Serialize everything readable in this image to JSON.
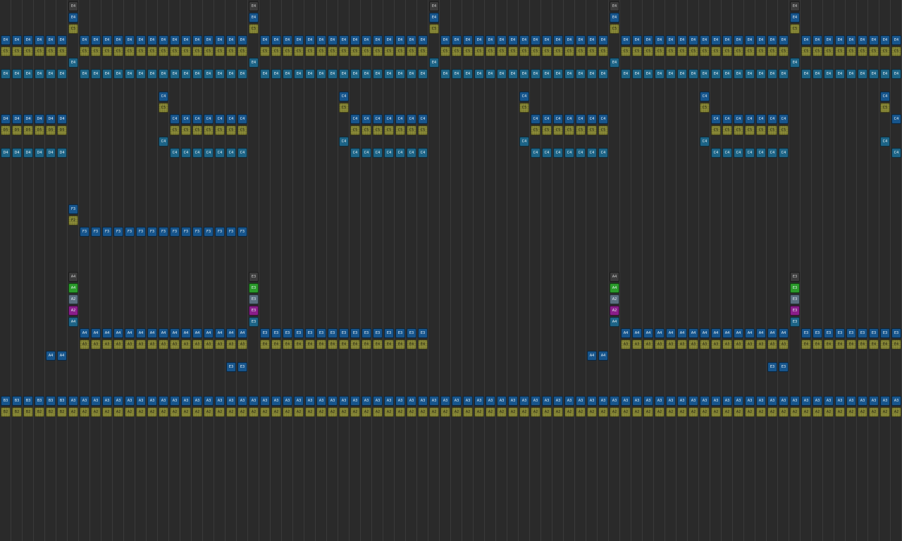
{
  "palette": {
    "background": "#2a2a2a",
    "gridline": "#3a3a3a",
    "dark": "#3c3c3c",
    "blue": "#17558c",
    "teal": "#1d6486",
    "olive": "#8b8b38",
    "green": "#2a9a2a",
    "slate": "#5a6f80",
    "purple": "#8a1e8a"
  },
  "note_rows": [
    {
      "name": "row-e4-top",
      "cols": [
        6,
        22,
        38,
        54,
        70
      ],
      "label": "E4",
      "style": "dark"
    },
    {
      "name": "row-e4-second",
      "cols": [
        6,
        22,
        38,
        54,
        70
      ],
      "label": "E4",
      "style": "blue"
    },
    {
      "name": "row-c5-top",
      "cols": [
        6,
        22,
        38,
        54,
        70
      ],
      "label": "C5",
      "style": "olive"
    },
    {
      "name": "row-e4-run",
      "cols": [
        0,
        1,
        2,
        3,
        4,
        5,
        7,
        8,
        9,
        10,
        11,
        12,
        13,
        14,
        15,
        16,
        17,
        18,
        19,
        20,
        21,
        23,
        24,
        25,
        26,
        27,
        28,
        29,
        30,
        31,
        32,
        33,
        34,
        35,
        36,
        37,
        39,
        40,
        41,
        42,
        43,
        44,
        45,
        46,
        47,
        48,
        49,
        50,
        51,
        52,
        53,
        55,
        56,
        57,
        58,
        59,
        60,
        61,
        62,
        63,
        64,
        65,
        66,
        67,
        68,
        69,
        71,
        72,
        73,
        74,
        75,
        76,
        77,
        78,
        79
      ],
      "label": "E4",
      "style": "blue"
    },
    {
      "name": "row-c5-run",
      "cols": [
        0,
        1,
        2,
        3,
        4,
        5,
        7,
        8,
        9,
        10,
        11,
        12,
        13,
        14,
        15,
        16,
        17,
        18,
        19,
        20,
        21,
        23,
        24,
        25,
        26,
        27,
        28,
        29,
        30,
        31,
        32,
        33,
        34,
        35,
        36,
        37,
        39,
        40,
        41,
        42,
        43,
        44,
        45,
        46,
        47,
        48,
        49,
        50,
        51,
        52,
        53,
        55,
        56,
        57,
        58,
        59,
        60,
        61,
        62,
        63,
        64,
        65,
        66,
        67,
        68,
        69,
        71,
        72,
        73,
        74,
        75,
        76,
        77,
        78,
        79
      ],
      "label": "C5",
      "style": "olive"
    },
    {
      "name": "row-e4-single",
      "cols": [
        6,
        22,
        38,
        54,
        70
      ],
      "label": "E4",
      "style": "teal"
    },
    {
      "name": "row-e4-run-lower",
      "cols": [
        0,
        1,
        2,
        3,
        4,
        5,
        7,
        8,
        9,
        10,
        11,
        12,
        13,
        14,
        15,
        16,
        17,
        18,
        19,
        20,
        21,
        23,
        24,
        25,
        26,
        27,
        28,
        29,
        30,
        31,
        32,
        33,
        34,
        35,
        36,
        37,
        39,
        40,
        41,
        42,
        43,
        44,
        45,
        46,
        47,
        48,
        49,
        50,
        51,
        52,
        53,
        55,
        56,
        57,
        58,
        59,
        60,
        61,
        62,
        63,
        64,
        65,
        66,
        67,
        68,
        69,
        71,
        72,
        73,
        74,
        75,
        76,
        77,
        78,
        79
      ],
      "label": "E4",
      "style": "teal"
    },
    {
      "name": "row-c4-single",
      "cols": [
        14,
        30,
        46,
        62,
        78
      ],
      "label": "C4",
      "style": "blue"
    },
    {
      "name": "row-c5-single",
      "cols": [
        14,
        30,
        46,
        62,
        78
      ],
      "label": "C5",
      "style": "olive"
    },
    {
      "name": "row-d4-run",
      "cols": [
        0,
        1,
        2,
        3,
        4,
        5
      ],
      "label": "D4",
      "style": "blue"
    },
    {
      "name": "row-c4-run",
      "cols": [
        15,
        16,
        17,
        18,
        19,
        20,
        21,
        31,
        32,
        33,
        34,
        35,
        36,
        37,
        47,
        48,
        49,
        50,
        51,
        52,
        53,
        63,
        64,
        65,
        66,
        67,
        68,
        69,
        79
      ],
      "label": "C4",
      "style": "blue"
    },
    {
      "name": "row-d5-run",
      "cols": [
        0,
        1,
        2,
        3,
        4,
        5
      ],
      "label": "D5",
      "style": "olive"
    },
    {
      "name": "row-c5-run-mid",
      "cols": [
        15,
        16,
        17,
        18,
        19,
        20,
        21,
        31,
        32,
        33,
        34,
        35,
        36,
        37,
        47,
        48,
        49,
        50,
        51,
        52,
        53,
        63,
        64,
        65,
        66,
        67,
        68,
        69
      ],
      "label": "C5",
      "style": "olive"
    },
    {
      "name": "row-c4-teal-single",
      "cols": [
        14,
        30,
        46,
        62,
        78
      ],
      "label": "C4",
      "style": "teal"
    },
    {
      "name": "row-d4-run-lower",
      "cols": [
        0,
        1,
        2,
        3,
        4,
        5
      ],
      "label": "D4",
      "style": "teal"
    },
    {
      "name": "row-c4-run-lower",
      "cols": [
        15,
        16,
        17,
        18,
        19,
        20,
        21,
        31,
        32,
        33,
        34,
        35,
        36,
        37,
        47,
        48,
        49,
        50,
        51,
        52,
        53,
        63,
        64,
        65,
        66,
        67,
        68,
        69,
        79
      ],
      "label": "C4",
      "style": "teal"
    },
    {
      "name": "row-f3-single",
      "cols": [
        6
      ],
      "label": "F3",
      "style": "blue"
    },
    {
      "name": "row-f2-single",
      "cols": [
        6
      ],
      "label": "F2",
      "style": "olive"
    },
    {
      "name": "row-f3-run",
      "cols": [
        7,
        8,
        9,
        10,
        11,
        12,
        13,
        14,
        15,
        16,
        17,
        18,
        19,
        20,
        21
      ],
      "label": "F3",
      "style": "blue"
    },
    {
      "name": "row-a4-top",
      "cols": [
        6,
        54
      ],
      "label": "A4",
      "style": "dark"
    },
    {
      "name": "row-e3-top",
      "cols": [
        22,
        70
      ],
      "label": "E3",
      "style": "dark"
    },
    {
      "name": "row-a4-green",
      "cols": [
        6,
        54
      ],
      "label": "A4",
      "style": "green"
    },
    {
      "name": "row-e3-green",
      "cols": [
        22,
        70
      ],
      "label": "E3",
      "style": "green"
    },
    {
      "name": "row-a2-slate",
      "cols": [
        6,
        54
      ],
      "label": "A2",
      "style": "slate"
    },
    {
      "name": "row-e3-slate",
      "cols": [
        22,
        70
      ],
      "label": "E3",
      "style": "slate"
    },
    {
      "name": "row-a2-purple",
      "cols": [
        6,
        54
      ],
      "label": "A2",
      "style": "purple"
    },
    {
      "name": "row-e3-purple",
      "cols": [
        22,
        70
      ],
      "label": "E3",
      "style": "purple"
    },
    {
      "name": "row-a4-teal",
      "cols": [
        6,
        54
      ],
      "label": "A4",
      "style": "teal"
    },
    {
      "name": "row-e3-teal",
      "cols": [
        22,
        70
      ],
      "label": "E3",
      "style": "teal"
    },
    {
      "name": "row-a4-run",
      "cols": [
        7,
        8,
        9,
        10,
        11,
        12,
        13,
        14,
        15,
        16,
        17,
        18,
        19,
        20,
        21,
        55,
        56,
        57,
        58,
        59,
        60,
        61,
        62,
        63,
        64,
        65,
        66,
        67,
        68,
        69
      ],
      "label": "A4",
      "style": "blue"
    },
    {
      "name": "row-e3-run",
      "cols": [
        23,
        24,
        25,
        26,
        27,
        28,
        29,
        30,
        31,
        32,
        33,
        34,
        35,
        36,
        37,
        71,
        72,
        73,
        74,
        75,
        76,
        77,
        78,
        79
      ],
      "label": "E3",
      "style": "blue"
    },
    {
      "name": "row-a3-olive-run",
      "cols": [
        7,
        8,
        9,
        10,
        11,
        12,
        13,
        14,
        15,
        16,
        17,
        18,
        19,
        20,
        21,
        55,
        56,
        57,
        58,
        59,
        60,
        61,
        62,
        63,
        64,
        65,
        66,
        67,
        68,
        69
      ],
      "label": "A3",
      "style": "olive"
    },
    {
      "name": "row-e4-olive-run",
      "cols": [
        23,
        24,
        25,
        26,
        27,
        28,
        29,
        30,
        31,
        32,
        33,
        34,
        35,
        36,
        37,
        71,
        72,
        73,
        74,
        75,
        76,
        77,
        78,
        79
      ],
      "label": "E4",
      "style": "olive"
    },
    {
      "name": "row-a4-pair",
      "cols": [
        4,
        5,
        52,
        53
      ],
      "label": "A4",
      "style": "blue"
    },
    {
      "name": "row-e3-pair",
      "cols": [
        20,
        21,
        68,
        69
      ],
      "label": "E3",
      "style": "blue"
    },
    {
      "name": "row-b3-run",
      "cols": [
        0,
        1,
        2,
        3,
        4,
        5
      ],
      "label": "B3",
      "style": "blue"
    },
    {
      "name": "row-a3-run",
      "cols": [
        6,
        7,
        8,
        9,
        10,
        11,
        12,
        13,
        14,
        15,
        16,
        17,
        18,
        19,
        20,
        21,
        22,
        23,
        24,
        25,
        26,
        27,
        28,
        29,
        30,
        31,
        32,
        33,
        34,
        35,
        36,
        37,
        38,
        39,
        40,
        41,
        42,
        43,
        44,
        45,
        46,
        47,
        48,
        49,
        50,
        51,
        52,
        53,
        54,
        55,
        56,
        57,
        58,
        59,
        60,
        61,
        62,
        63,
        64,
        65,
        66,
        67,
        68,
        69,
        70,
        71,
        72,
        73,
        74,
        75,
        76,
        77,
        78,
        79
      ],
      "label": "A3",
      "style": "blue"
    },
    {
      "name": "row-b2-run",
      "cols": [
        0,
        1,
        2,
        3,
        4,
        5
      ],
      "label": "B2",
      "style": "olive"
    },
    {
      "name": "row-a2-run",
      "cols": [
        6,
        7,
        8,
        9,
        10,
        11,
        12,
        13,
        14,
        15,
        16,
        17,
        18,
        19,
        20,
        21,
        22,
        23,
        24,
        25,
        26,
        27,
        28,
        29,
        30,
        31,
        32,
        33,
        34,
        35,
        36,
        37,
        38,
        39,
        40,
        41,
        42,
        43,
        44,
        45,
        46,
        47,
        48,
        49,
        50,
        51,
        52,
        53,
        54,
        55,
        56,
        57,
        58,
        59,
        60,
        61,
        62,
        63,
        64,
        65,
        66,
        67,
        68,
        69,
        70,
        71,
        72,
        73,
        74,
        75,
        76,
        77,
        78,
        79
      ],
      "label": "A2",
      "style": "olive"
    }
  ]
}
